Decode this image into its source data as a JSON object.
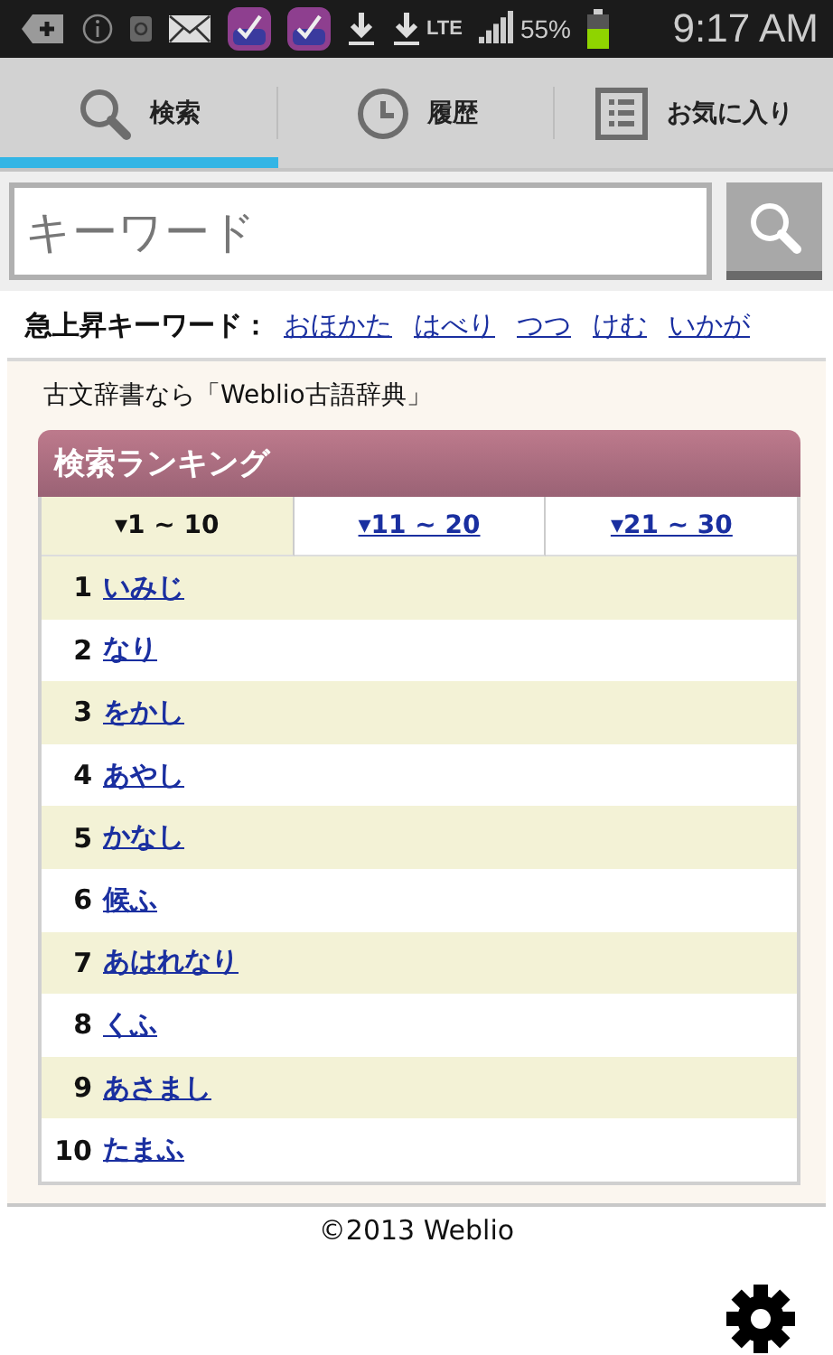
{
  "status_bar": {
    "network": "LTE",
    "battery_percent": "55%",
    "time": "9:17 AM"
  },
  "nav_tabs": [
    {
      "label": "検索",
      "kind": "search",
      "selected": true
    },
    {
      "label": "履歴",
      "kind": "history",
      "selected": false
    },
    {
      "label": "お気に入り",
      "kind": "favorites",
      "selected": false
    }
  ],
  "search": {
    "placeholder": "キーワード"
  },
  "trending": {
    "label": "急上昇キーワード：",
    "keywords": [
      "おほかた",
      "はべり",
      "つつ",
      "けむ",
      "いかが"
    ]
  },
  "promo": "古文辞書なら「Weblio古語辞典」",
  "ranking": {
    "title": "検索ランキング",
    "tabs": [
      {
        "label": "▾1 ~ 10",
        "selected": true
      },
      {
        "label": "▾11 ~ 20",
        "selected": false
      },
      {
        "label": "▾21 ~ 30",
        "selected": false
      }
    ],
    "rows": [
      {
        "rank": "1",
        "word": "いみじ"
      },
      {
        "rank": "2",
        "word": "なり"
      },
      {
        "rank": "3",
        "word": "をかし"
      },
      {
        "rank": "4",
        "word": "あやし"
      },
      {
        "rank": "5",
        "word": "かなし"
      },
      {
        "rank": "6",
        "word": "候ふ"
      },
      {
        "rank": "7",
        "word": "あはれなり"
      },
      {
        "rank": "8",
        "word": "くふ"
      },
      {
        "rank": "9",
        "word": "あさまし"
      },
      {
        "rank": "10",
        "word": "たまふ"
      }
    ]
  },
  "footer": "©2013 Weblio"
}
